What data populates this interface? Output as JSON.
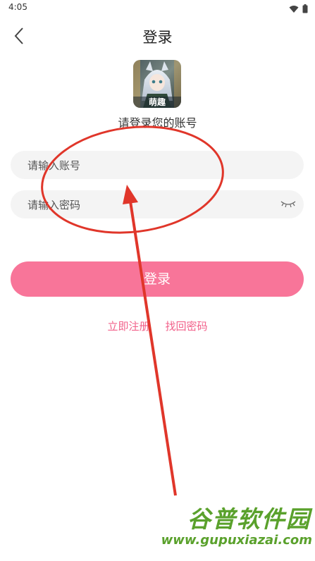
{
  "status_bar": {
    "time": "4:05",
    "icons": [
      "wifi-icon",
      "battery-icon"
    ]
  },
  "header": {
    "title": "登录",
    "back_icon": "chevron-left-icon"
  },
  "app": {
    "logo_text": "萌趣"
  },
  "subtitle": "请登录您的账号",
  "form": {
    "account_placeholder": "请输入账号",
    "account_value": "",
    "password_placeholder": "请输入密码",
    "password_value": "",
    "password_toggle_icon": "eye-closed-icon"
  },
  "login_button_label": "登录",
  "links": {
    "register": "立即注册",
    "forgot_password": "找回密码"
  },
  "colors": {
    "accent": "#f87599",
    "link": "#f2608a",
    "annotation": "#e0362a",
    "watermark": "#5aa12c"
  },
  "watermark": {
    "name": "谷普软件园",
    "url": "www.gupuxiazai.com"
  }
}
